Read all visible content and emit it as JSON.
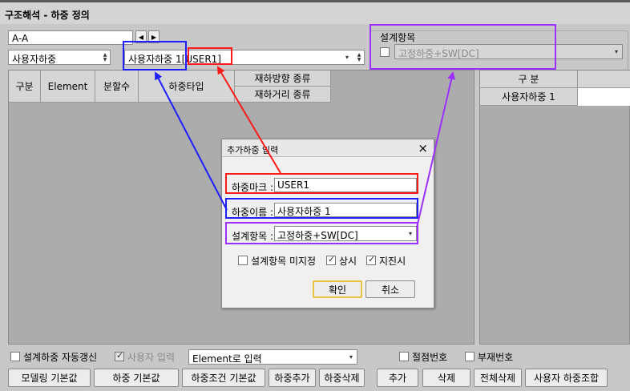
{
  "window": {
    "title": "구조해석 - 하중 정의"
  },
  "top": {
    "section_combo": "A-A",
    "load_type_combo": "사용자하중",
    "load_name_combo": "사용자하중 1[USER1]",
    "design_item": {
      "label": "설계항목",
      "value": "고정하중+SW[DC]"
    }
  },
  "table": {
    "headers": [
      "구분",
      "Element",
      "분할수",
      "하중타입"
    ],
    "sub_headers": [
      "재하방향 종류",
      "재하거리 종류"
    ]
  },
  "right_table": {
    "header": "구 분",
    "rows": [
      "사용자하중 1"
    ]
  },
  "dialog": {
    "title": "추가하중 입력",
    "close": "×",
    "mark_label": "하중마크 :",
    "mark_value": "USER1",
    "name_label": "하중이름 :",
    "name_value": "사용자하중 1",
    "design_label": "설계항목 :",
    "design_value": "고정하중+SW[DC]",
    "chk_unassigned": "설계항목 미지정",
    "chk_normal": "상시",
    "chk_seismic": "지진시",
    "ok": "확인",
    "cancel": "취소"
  },
  "bottom": {
    "auto_update": "설계하중 자동갱신",
    "user_input": "사용자 입력",
    "input_mode": "Element로 입력",
    "node_no": "절점번호",
    "member_no": "부재번호",
    "buttons": [
      "모델링 기본값",
      "하중 기본값",
      "하중조건 기본값",
      "하중추가",
      "하중삭제",
      "추가",
      "삭제",
      "전체삭제",
      "사용자 하중조합"
    ]
  },
  "colors": {
    "red": "#ff1a1a",
    "blue": "#1e1eff",
    "purple": "#9b30ff"
  }
}
